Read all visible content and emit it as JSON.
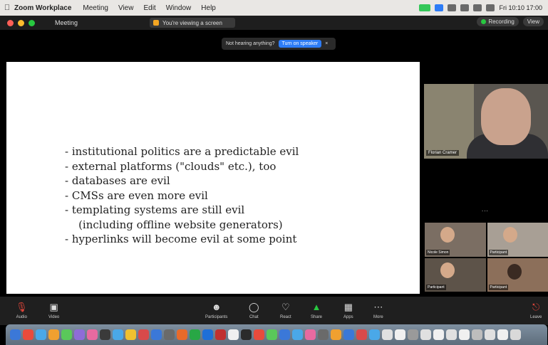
{
  "menubar": {
    "apple": "",
    "app_name": "Zoom Workplace",
    "items": [
      "Meeting",
      "View",
      "Edit",
      "Window",
      "Help"
    ],
    "clock": "Fri 10:10 17:00"
  },
  "titlebar": {
    "meeting_title": "Meeting",
    "share_banner": "You're viewing a screen",
    "view_label": "View",
    "recording_label": "Recording"
  },
  "notice": {
    "text": "Not hearing anything?",
    "button": "Turn on speaker"
  },
  "slide": {
    "bullets": [
      "- institutional politics are a predictable evil",
      "- external platforms (\"clouds\" etc.), too",
      "- databases are evil",
      "- CMSs are even more evil",
      "- templating systems are still evil",
      "    (including offline website generators)",
      "- hyperlinks will become evil at some point"
    ]
  },
  "speaker": {
    "name": "Florian Cramer"
  },
  "more": "...",
  "gallery": [
    {
      "name": "Nicole Simon"
    },
    {
      "name": "Participant"
    },
    {
      "name": "Participant"
    },
    {
      "name": "Participant"
    }
  ],
  "controls": {
    "audio": {
      "icon": "mic-muted-icon",
      "label": "Audio"
    },
    "video": {
      "icon": "video-icon",
      "label": "Video"
    },
    "participants": {
      "icon": "participants-icon",
      "label": "Participants"
    },
    "chat": {
      "icon": "chat-icon",
      "label": "Chat"
    },
    "react": {
      "icon": "react-icon",
      "label": "React"
    },
    "share": {
      "icon": "share-icon",
      "label": "Share"
    },
    "apps": {
      "icon": "apps-icon",
      "label": "Apps"
    },
    "more": {
      "icon": "more-icon",
      "label": "More"
    },
    "leave": {
      "icon": "leave-icon",
      "label": "Leave"
    }
  },
  "colors": {
    "slide_bg": "#ffffff",
    "app_bg": "#000000",
    "accent_blue": "#2d7cf6",
    "share_green": "#28c840",
    "mute_red": "#e0453a"
  },
  "dock": [
    "#3b78d8",
    "#e94b3c",
    "#4aa8e8",
    "#f0a030",
    "#5ac85a",
    "#8e6cd8",
    "#e86aa0",
    "#3a3a3a",
    "#4aa8e8",
    "#f0c030",
    "#d84a4a",
    "#3b78d8",
    "#6a6a6a",
    "#e86a2a",
    "#28a745",
    "#1e6fd8",
    "#c03030",
    "#f0f0f0",
    "#2b2b2b",
    "#e94b3c",
    "#5ac85a",
    "#3b78d8",
    "#4aa8e8",
    "#e86aa0",
    "#6a6a6a",
    "#f0a030",
    "#3b78d8",
    "#d84a4a",
    "#4aa8e8",
    "#e0e0e0",
    "#f0f0f0",
    "#9a9a9a",
    "#e0e0e0",
    "#f0f0f0",
    "#e0e0e0",
    "#f0f0f0",
    "#bdbdbd",
    "#e0e0e0",
    "#f0f0f0",
    "#d9d9d9"
  ]
}
